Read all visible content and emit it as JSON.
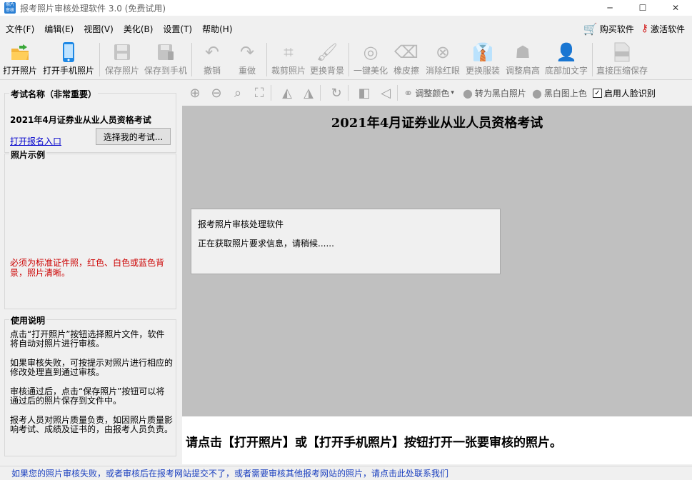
{
  "window": {
    "title": "报考照片审核处理软件 3.0 (免费试用)",
    "app_icon_text": "照片审核",
    "controls": [
      "─",
      "☐",
      "✕"
    ]
  },
  "menu": {
    "items": [
      "文件(F)",
      "编辑(E)",
      "视图(V)",
      "美化(B)",
      "设置(T)",
      "帮助(H)"
    ],
    "buy": "购买软件",
    "activate": "激活软件"
  },
  "toolbar": {
    "buttons": [
      {
        "label": "打开照片",
        "icon": "folder-open-icon"
      },
      {
        "label": "打开手机照片",
        "icon": "phone-icon"
      },
      {
        "label": "保存照片",
        "icon": "save-icon"
      },
      {
        "label": "保存到手机",
        "icon": "save-phone-icon"
      },
      {
        "label": "撤销",
        "icon": "undo-icon"
      },
      {
        "label": "重做",
        "icon": "redo-icon"
      },
      {
        "label": "裁剪照片",
        "icon": "crop-icon"
      },
      {
        "label": "更换背景",
        "icon": "brush-icon"
      },
      {
        "label": "一键美化",
        "icon": "beautify-icon"
      },
      {
        "label": "橡皮擦",
        "icon": "eraser-icon"
      },
      {
        "label": "消除红眼",
        "icon": "red-eye-icon"
      },
      {
        "label": "更换服装",
        "icon": "suit-icon"
      },
      {
        "label": "调整肩高",
        "icon": "shoulder-icon"
      },
      {
        "label": "底部加文字",
        "icon": "add-text-icon"
      },
      {
        "label": "直接压缩保存",
        "icon": "jpg-icon"
      }
    ]
  },
  "left": {
    "exam_group_title": "考试名称（非常重要）",
    "exam_name": "2021年4月证券业从业人员资格考试",
    "reg_link": "打开报名入口",
    "choose_button": "选择我的考试...",
    "sample_title": "照片示例",
    "sample_note": "必须为标准证件照，红色、白色或蓝色背景，照片清晰。",
    "instr_title": "使用说明",
    "instructions": [
      "点击“打开照片”按钮选择照片文件，软件将自动对照片进行审核。",
      "如果审核失败，可按提示对照片进行相应的修改处理直到通过审核。",
      "审核通过后，点击“保存照片”按钮可以将通过后的照片保存到文件中。",
      "报考人员对照片质量负责，如因照片质量影响考试、成绩及证书的，由报考人员负责。"
    ]
  },
  "image_toolbar": {
    "adjust_color": "调整颜色",
    "to_bw": "转为黑白照片",
    "bw_colorize": "黑白图上色",
    "face_detect": "启用人脸识别",
    "face_detect_checked": true
  },
  "canvas": {
    "title": "2021年4月证券业从业人员资格考试",
    "dialog_title": "报考照片审核处理软件",
    "dialog_message": "正在获取照片要求信息，请稍候......"
  },
  "hint": "请点击【打开照片】或【打开手机照片】按钮打开一张要审核的照片。",
  "status": "如果您的照片审核失败，或者审核后在报考网站提交不了，或者需要审核其他报考网站的照片，请点击此处联系我们",
  "colors": {
    "canvas_bg": "#c0c0c0",
    "link": "#0000cc",
    "warning": "#cc0000",
    "status_link": "#1a3fbf"
  }
}
